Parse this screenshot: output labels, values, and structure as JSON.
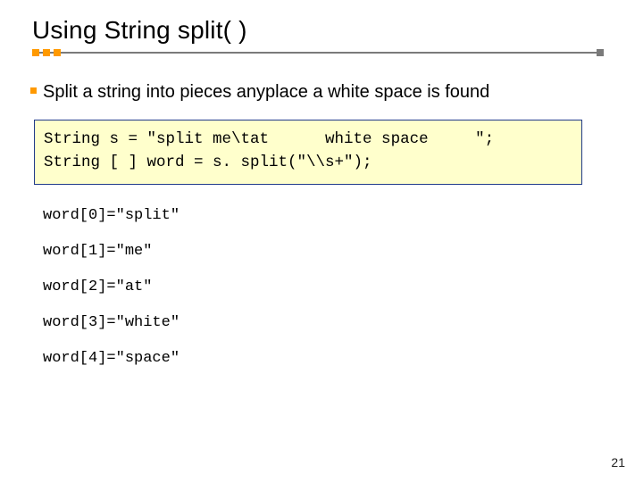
{
  "title": "Using String split( )",
  "lead": "Split a string into pieces anyplace a white space is found",
  "code": {
    "line1": "String s = \"split me\\tat      white space     \";",
    "line2": "String [ ] word = s. split(\"\\\\s+\");"
  },
  "results": [
    "word[0]=\"split\"",
    "word[1]=\"me\"",
    "word[2]=\"at\"",
    "word[3]=\"white\"",
    "word[4]=\"space\""
  ],
  "page_number": "21"
}
